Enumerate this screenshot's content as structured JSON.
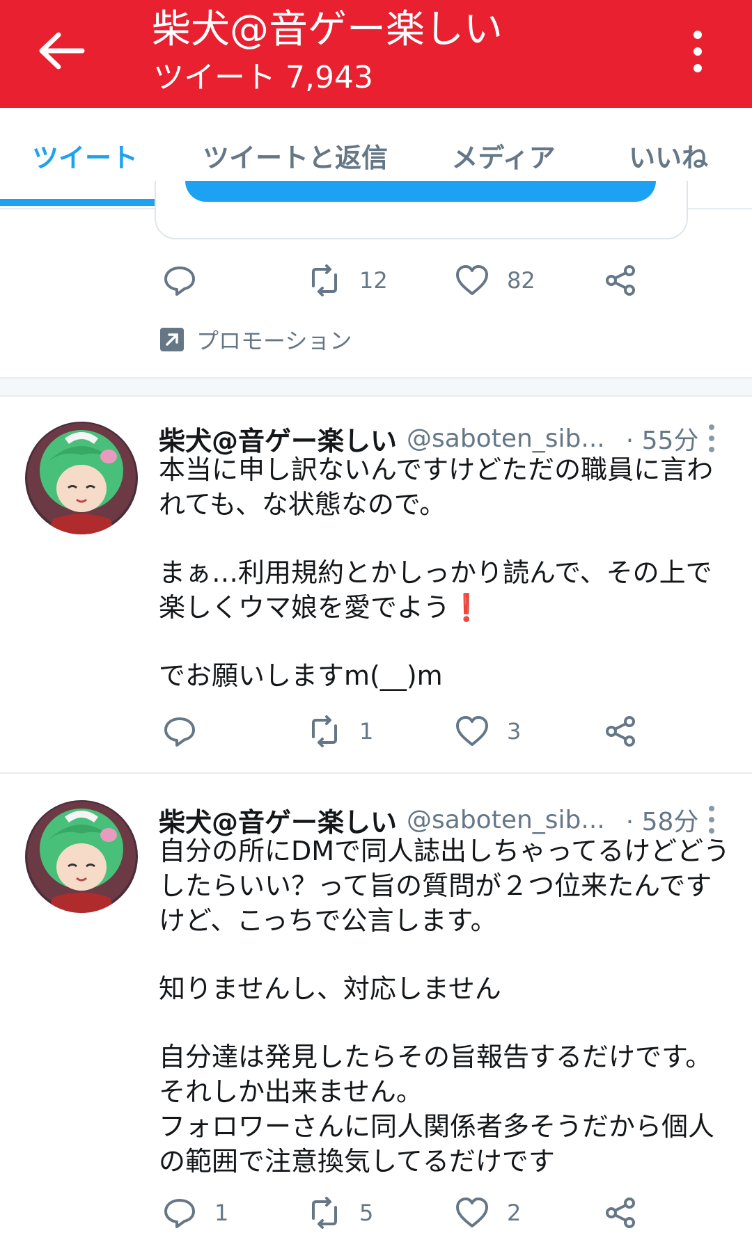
{
  "header": {
    "title": "柴犬@音ゲー楽しい",
    "subtitle": "ツイート 7,943",
    "bg_color": "#e8202f"
  },
  "tabs": [
    {
      "label": "ツイート",
      "active": true
    },
    {
      "label": "ツイートと返信",
      "active": false
    },
    {
      "label": "メディア",
      "active": false
    },
    {
      "label": "いいね",
      "active": false
    }
  ],
  "promo_tweet": {
    "retweets": "12",
    "likes": "82",
    "promoted_label": "プロモーション"
  },
  "tweets": [
    {
      "name": "柴犬@音ゲー楽しい",
      "handle": "@saboten_sib...",
      "time": "· 55分",
      "lines": [
        "本当に申し訳ないんですけどただの職員に言わ",
        "れても、な状態なので。",
        "",
        "まぁ…利用規約とかしっかり読んで、その上で",
        "楽しくウマ娘を愛でよう❗",
        "",
        "でお願いしますm(__)m"
      ],
      "replies": "",
      "retweets": "1",
      "likes": "3"
    },
    {
      "name": "柴犬@音ゲー楽しい",
      "handle": "@saboten_sib...",
      "time": "· 58分",
      "lines": [
        "自分の所にDMで同人誌出しちゃってるけどどう",
        "したらいい？って旨の質問が２つ位来たんです",
        "けど、こっちで公言します。",
        "",
        "知りませんし、対応しません",
        "",
        "自分達は発見したらその旨報告するだけです。",
        "それしか出来ません。",
        "フォロワーさんに同人関係者多そうだから個人",
        "の範囲で注意換気してるだけです"
      ],
      "replies": "1",
      "retweets": "5",
      "likes": "2"
    }
  ],
  "colors": {
    "accent": "#1da1f2",
    "muted": "#657786",
    "divider": "#e6ecf0"
  }
}
